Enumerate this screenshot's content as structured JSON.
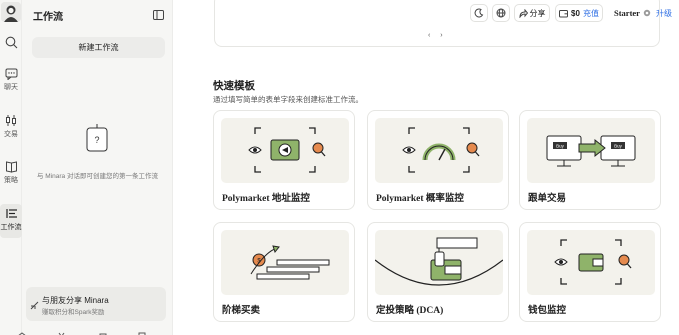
{
  "rail": {
    "items": [
      {
        "icon": "search-icon",
        "label": ""
      },
      {
        "icon": "chat-icon",
        "label": "聊天"
      },
      {
        "icon": "candlestick-icon",
        "label": "交易"
      },
      {
        "icon": "book-icon",
        "label": "策略"
      },
      {
        "icon": "workflow-icon",
        "label": "工作流"
      }
    ]
  },
  "sidebar": {
    "title": "工作流",
    "new_button": "新建工作流",
    "empty_hint": "与 Minara 对话即可创建您的第一条工作流",
    "share_title": "与朋友分享 Minara",
    "share_sub": "赚取积分和Spark奖励"
  },
  "topbar": {
    "share": "分享",
    "credit": "$0",
    "topup": "充值",
    "plan": "Starter",
    "upgrade": "升级"
  },
  "main": {
    "pager": "‹ ›",
    "section_title": "快速模板",
    "section_sub": "通过填写简单的表单字段来创建标准工作流。",
    "templates": [
      {
        "label": "Polymarket 地址监控"
      },
      {
        "label": "Polymarket 概率监控"
      },
      {
        "label": "跟单交易",
        "art_text_left": "Buy",
        "art_text_right": "Buy"
      },
      {
        "label": "阶梯买卖"
      },
      {
        "label": "定投策略 (DCA)"
      },
      {
        "label": "钱包监控"
      }
    ]
  },
  "colors": {
    "accent_blue": "#2f6fe4",
    "art_green": "#8fb36a",
    "art_bg": "#f3f2ec",
    "art_orange": "#e58a4e"
  }
}
